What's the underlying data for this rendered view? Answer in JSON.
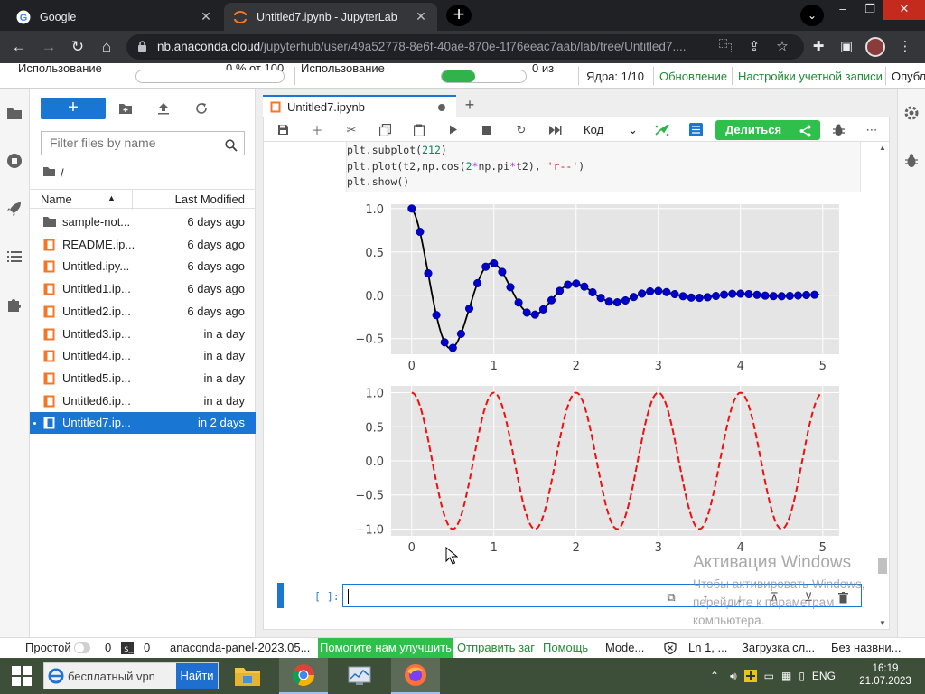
{
  "browser": {
    "tabs": [
      {
        "title": "Google"
      },
      {
        "title": "Untitled7.ipynb - JupyterLab"
      }
    ],
    "new_tab": "+",
    "url_host": "nb.anaconda.cloud",
    "url_path": "/jupyterhub/user/49a52778-8e6f-40ae-870e-1f76eeac7aab/lab/tree/Untitled7...."
  },
  "topstrip": {
    "usage_label_1": "Использование",
    "usage_value_1": "0 % от 100",
    "usage_progress_1": 0,
    "usage_label_2": "Использование",
    "usage_value_2": "0 из",
    "usage_progress_2": 0.4,
    "cores": "Ядра: 1/10",
    "update": "Обновление",
    "account_settings": "Настройки учетной записи",
    "publish": "Опубл"
  },
  "filebrowser": {
    "new_label": "+",
    "filter_placeholder": "Filter files by name",
    "breadcrumb": "/",
    "col_name": "Name",
    "col_modified": "Last Modified",
    "files": [
      {
        "name": "sample-not...",
        "modified": "6 days ago",
        "type": "folder"
      },
      {
        "name": "README.ip...",
        "modified": "6 days ago",
        "type": "notebook"
      },
      {
        "name": "Untitled.ipy...",
        "modified": "6 days ago",
        "type": "notebook"
      },
      {
        "name": "Untitled1.ip...",
        "modified": "6 days ago",
        "type": "notebook"
      },
      {
        "name": "Untitled2.ip...",
        "modified": "6 days ago",
        "type": "notebook"
      },
      {
        "name": "Untitled3.ip...",
        "modified": "in a day",
        "type": "notebook"
      },
      {
        "name": "Untitled4.ip...",
        "modified": "in a day",
        "type": "notebook"
      },
      {
        "name": "Untitled5.ip...",
        "modified": "in a day",
        "type": "notebook"
      },
      {
        "name": "Untitled6.ip...",
        "modified": "in a day",
        "type": "notebook"
      },
      {
        "name": "Untitled7.ip...",
        "modified": "in 2 days",
        "type": "notebook",
        "selected": true
      }
    ]
  },
  "notebook": {
    "tab_title": "Untitled7.ipynb",
    "add_tab": "+",
    "kernel_select": "Код",
    "share_label": "Делиться",
    "code_lines": [
      {
        "parts": [
          [
            "plt.subplot(",
            ""
          ],
          [
            "212",
            "num"
          ],
          [
            ")",
            ""
          ]
        ]
      },
      {
        "parts": [
          [
            "plt.plot(t2,np.cos(",
            ""
          ],
          [
            "2",
            "num"
          ],
          [
            "*",
            "op"
          ],
          [
            "np.pi",
            ""
          ],
          [
            "*",
            "op"
          ],
          [
            "t2), ",
            ""
          ],
          [
            "'r--'",
            "str"
          ],
          [
            ")",
            ""
          ]
        ]
      },
      {
        "parts": [
          [
            "plt.show()",
            ""
          ]
        ]
      }
    ],
    "prompt": "[ ]:"
  },
  "chart_data": [
    {
      "type": "line",
      "xlim": [
        -0.25,
        5.2
      ],
      "ylim": [
        -0.68,
        1.05
      ],
      "xticks": [
        0,
        1,
        2,
        3,
        4,
        5
      ],
      "yticks": [
        1.0,
        0.5,
        0.0,
        -0.5
      ],
      "ytick_labels": [
        "1.0",
        "0.5",
        "0.0",
        "−0.5"
      ],
      "grid": true,
      "series": [
        {
          "kind": "line",
          "color": "#000000",
          "function": "exp(-t)*cos(2*pi*t)",
          "x_range": [
            0,
            4.95
          ],
          "step": 0.02
        },
        {
          "kind": "markers",
          "color": "#0000cc",
          "function": "exp(-t)*cos(2*pi*t)",
          "x_range": [
            0,
            4.9
          ],
          "step": 0.1
        }
      ]
    },
    {
      "type": "line",
      "xlim": [
        -0.25,
        5.2
      ],
      "ylim": [
        -1.1,
        1.1
      ],
      "xticks": [
        0,
        1,
        2,
        3,
        4,
        5
      ],
      "yticks": [
        1.0,
        0.5,
        0.0,
        -0.5,
        -1.0
      ],
      "ytick_labels": [
        "1.0",
        "0.5",
        "0.0",
        "−0.5",
        "−1.0"
      ],
      "grid": true,
      "series": [
        {
          "kind": "dashed",
          "color": "#ee1111",
          "function": "cos(2*pi*t)",
          "x_range": [
            0,
            4.98
          ],
          "step": 0.02
        }
      ]
    }
  ],
  "statusbar": {
    "mode_simple": "Простой",
    "zero_a": "0",
    "zero_b": "0",
    "panel": "anaconda-panel-2023.05...",
    "help_improve": "Помогите нам улучшить",
    "send_bug": "Отправить заг",
    "help": "Помощь",
    "mode": "Mode...",
    "ln": "Ln 1, ...",
    "loading": "Загрузка сл...",
    "untitled": "Без назвни..."
  },
  "watermark": {
    "title": "Активация Windows",
    "line1": "Чтобы активировать Windows,",
    "line2": "перейдите к параметрам",
    "line3": "компьютера."
  },
  "taskbar": {
    "search_query": "бесплатный vpn",
    "search_button": "Найти",
    "lang": "ENG",
    "time": "16:19",
    "date": "21.07.2023"
  }
}
